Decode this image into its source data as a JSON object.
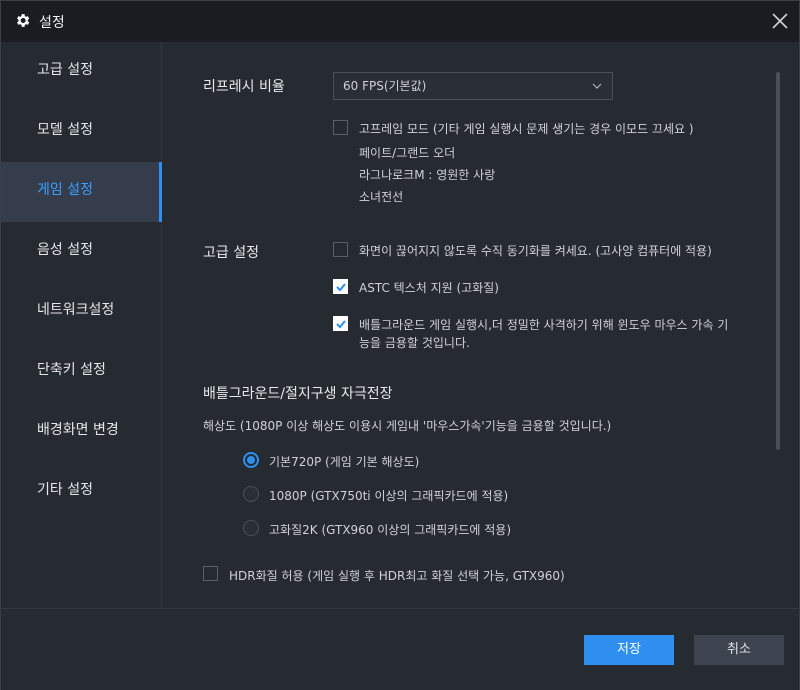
{
  "window": {
    "title": "설정"
  },
  "sidebar": {
    "items": [
      {
        "label": "고급 설정"
      },
      {
        "label": "모델 설정"
      },
      {
        "label": "게임 설정",
        "active": true
      },
      {
        "label": "음성 설정"
      },
      {
        "label": "네트워크설정"
      },
      {
        "label": "단축키 설정"
      },
      {
        "label": "배경화면 변경"
      },
      {
        "label": "기타 설정"
      }
    ]
  },
  "refresh": {
    "label": "리프레시 비율",
    "selected": "60 FPS(기본값)",
    "high_frame": {
      "label": "고프레임 모드  (기타 게임 실행시 문제 생기는 경우 이모드 끄세요 )",
      "checked": false
    },
    "games": [
      "페이트/그랜드 오더",
      "라그나로크M : 영원한 사랑",
      "소녀전선"
    ]
  },
  "advanced": {
    "label": "고급 설정",
    "vsync": {
      "label": "화면이 끊어지지 않도록 수직 동기화를 켜세요.   (고사양 컴퓨터에 적용)",
      "checked": false
    },
    "astc": {
      "label": "ASTC 텍스처 지원 (고화질)",
      "checked": true
    },
    "mouse": {
      "line1": "배틀그라운드 게임 실행시,더 정밀한 사격하기 위해 윈도우 마우스 가속 기",
      "line2": "능을 금용할 것입니다.",
      "checked": true
    }
  },
  "pubg": {
    "title": "배틀그라운드/절지구생 자극전장",
    "note": "해상도 (1080P 이상 해상도 이용시 게임내  '마우스가속'기능을 금용할 것입니다.)",
    "options": [
      {
        "label": "기본720P  (게임 기본 해상도)",
        "selected": true
      },
      {
        "label": "1080P (GTX750ti 이상의 그래픽카드에 적용)",
        "selected": false
      },
      {
        "label": "고화질2K (GTX960 이상의 그래픽카드에 적용)",
        "selected": false
      }
    ],
    "hdr": {
      "label": "HDR화질 허용 (게임 실행 후 HDR최고 화질 선택 가능, GTX960)",
      "checked": false
    }
  },
  "footer": {
    "save": "저장",
    "cancel": "취소"
  },
  "colors": {
    "accent": "#2f8ff0",
    "active_text": "#3aa0ff"
  },
  "icons": {
    "title": "gear-icon",
    "close": "close-icon",
    "dropdown": "chevron-down-icon",
    "check": "checkmark-icon"
  }
}
